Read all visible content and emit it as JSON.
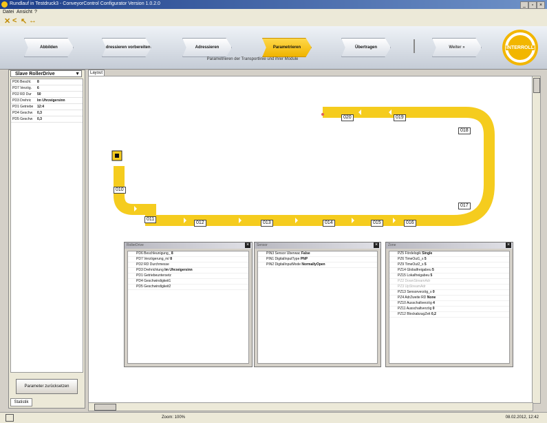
{
  "window": {
    "title": "Rundlauf in Testdruck3 - ConveyorControl Configurator Version 1.0.2.0",
    "buttons": [
      "_",
      "▫",
      "×"
    ]
  },
  "menu": [
    "Datei",
    "Ansicht",
    "?"
  ],
  "quick_tools": [
    "✕",
    "<",
    "↖",
    "↔"
  ],
  "steps": [
    {
      "label": "Abbilden"
    },
    {
      "label": "Adressieren vorbereiten"
    },
    {
      "label": "Adressieren"
    },
    {
      "label": "Parametrieren"
    },
    {
      "label": "Übertragen"
    },
    {
      "label": "Weiter »"
    }
  ],
  "step_subtitle": "Parametrieren der Transportlinie und ihrer Module",
  "logo_text": "INTERROLL",
  "left_panel": {
    "header": "Slave RollerDrive",
    "rows": [
      {
        "k": "PD6 Beschl.",
        "v": "8"
      },
      {
        "k": "PD7 Verzög.",
        "v": "6"
      },
      {
        "k": "PD2 RD Dur",
        "v": "50"
      },
      {
        "k": "PD3 Drehric",
        "v": "Im Uhrzeigersinn"
      },
      {
        "k": "PD1 Getriebe",
        "v": "12:4"
      },
      {
        "k": "PD4 Geschw",
        "v": "0,3"
      },
      {
        "k": "PD5 Geschw",
        "v": "0,3"
      }
    ],
    "reset_button": "Parameter zurücksetzen",
    "tab_label": "Statistik"
  },
  "layout_tab": "Layout",
  "conveyor": {
    "segments": [
      "010",
      "011",
      "012",
      "013",
      "014",
      "015",
      "016",
      "017",
      "018",
      "019",
      "020"
    ]
  },
  "panel1": {
    "title": "RollerDrive",
    "rows": [
      {
        "k": "PD6 Beschleunigung_",
        "v": "8"
      },
      {
        "k": "PD7 Verzögerung_m/",
        "v": "8"
      },
      {
        "k": "PD2 RD Durchmesse",
        "v": ""
      },
      {
        "k": "PD3 Drehrichtung",
        "v": "Im Uhrzeigersinn"
      },
      {
        "k": "PD1 Getriebeuntersetz",
        "v": ""
      },
      {
        "k": "PD4 Geschwindigkeit1",
        "v": ""
      },
      {
        "k": "PD5 Geschwindigkeit2",
        "v": ""
      }
    ]
  },
  "panel2": {
    "title": "Sensor",
    "rows": [
      {
        "k": "PIN3 Sensor Überwac",
        "v": "False"
      },
      {
        "k": "PIN1 DigitalInputType",
        "v": "PNP"
      },
      {
        "k": "PIN2 DigitalInputMode",
        "v": "NormallyOpen"
      }
    ]
  },
  "panel3": {
    "title": "Zone",
    "rows": [
      {
        "k": "PZ5 Fördelogik",
        "v": "Single",
        "dim": false
      },
      {
        "k": "PZ6 TimeOut1_s",
        "v": "5",
        "dim": false
      },
      {
        "k": "PZ9 TimeOut2_s",
        "v": "5",
        "dim": false
      },
      {
        "k": "PZ14 Globalfreigabeu",
        "v": "5",
        "dim": false
      },
      {
        "k": "PZ15 Lokalfreigabeu",
        "v": "5",
        "dim": false
      },
      {
        "k": "PZ2 DownStreamAdr",
        "v": "",
        "dim": true
      },
      {
        "k": "PZ3 UpStreamAdr",
        "v": "",
        "dim": true
      },
      {
        "k": "PZ13 Sensorverzög_s",
        "v": "0",
        "dim": false
      },
      {
        "k": "PZ4 AdrZweite RD",
        "v": "None",
        "dim": false
      },
      {
        "k": "PZ10 Ausschaltverzög",
        "v": "4",
        "dim": false
      },
      {
        "k": "PZ11 Ausschaltverzög",
        "v": "0",
        "dim": false
      },
      {
        "k": "PZ12 BlockabzugZeit",
        "v": "0,2",
        "dim": false
      }
    ]
  },
  "status": {
    "zoom": "Zoom: 100%",
    "datetime": "08.02.2012, 12:42"
  },
  "colors": {
    "conveyor": "#f5cc1e",
    "active_step": "#f0b400",
    "logo": "#f2b600"
  }
}
